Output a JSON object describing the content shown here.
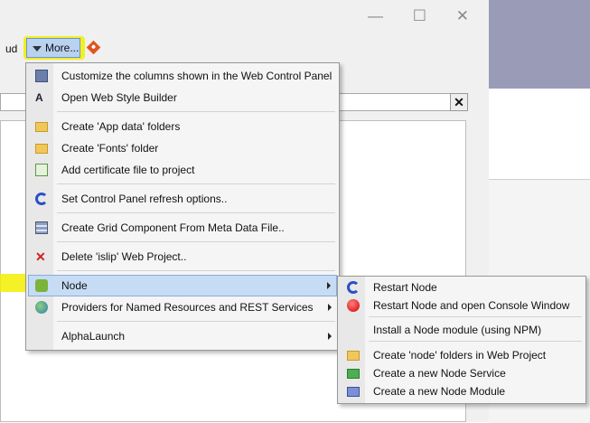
{
  "toolbar": {
    "partial_label": "ud",
    "more_label": "More..."
  },
  "window_controls": [
    "—",
    "☐",
    "✕"
  ],
  "search": {
    "clear_label": "✕"
  },
  "more_menu": {
    "items": [
      {
        "label": "Customize the columns shown in the Web Control Panel",
        "icon": "columns-icon"
      },
      {
        "label": "Open Web Style Builder",
        "icon": "style-builder-icon"
      },
      {
        "label": "Create 'App data' folders",
        "icon": "folder-icon"
      },
      {
        "label": "Create 'Fonts' folder",
        "icon": "folder-icon"
      },
      {
        "label": "Add certificate file to project",
        "icon": "certificate-icon"
      },
      {
        "label": "Set Control Panel refresh options..",
        "icon": "refresh-icon"
      },
      {
        "label": "Create Grid Component From Meta Data File..",
        "icon": "grid-icon"
      },
      {
        "label": "Delete 'islip' Web Project..",
        "icon": "delete-icon"
      },
      {
        "label": "Node",
        "icon": "node-icon"
      },
      {
        "label": "Providers for Named Resources and REST Services",
        "icon": "globe-icon"
      },
      {
        "label": "AlphaLaunch",
        "icon": ""
      }
    ]
  },
  "node_submenu": {
    "items": [
      {
        "label": "Restart Node",
        "icon": "refresh-icon"
      },
      {
        "label": "Restart Node and open Console Window",
        "icon": "red-circle-icon"
      },
      {
        "label": "Install a Node module (using NPM)",
        "icon": ""
      },
      {
        "label": "Create 'node' folders in Web Project",
        "icon": "folder-icon"
      },
      {
        "label": "Create a new Node Service",
        "icon": "green-cube-icon"
      },
      {
        "label": "Create a new Node Module",
        "icon": "blue-cube-icon"
      }
    ]
  },
  "colors": {
    "selection": "#c5dcf4",
    "highlight": "#f2ee00",
    "header_band": "#9a9bb6"
  }
}
